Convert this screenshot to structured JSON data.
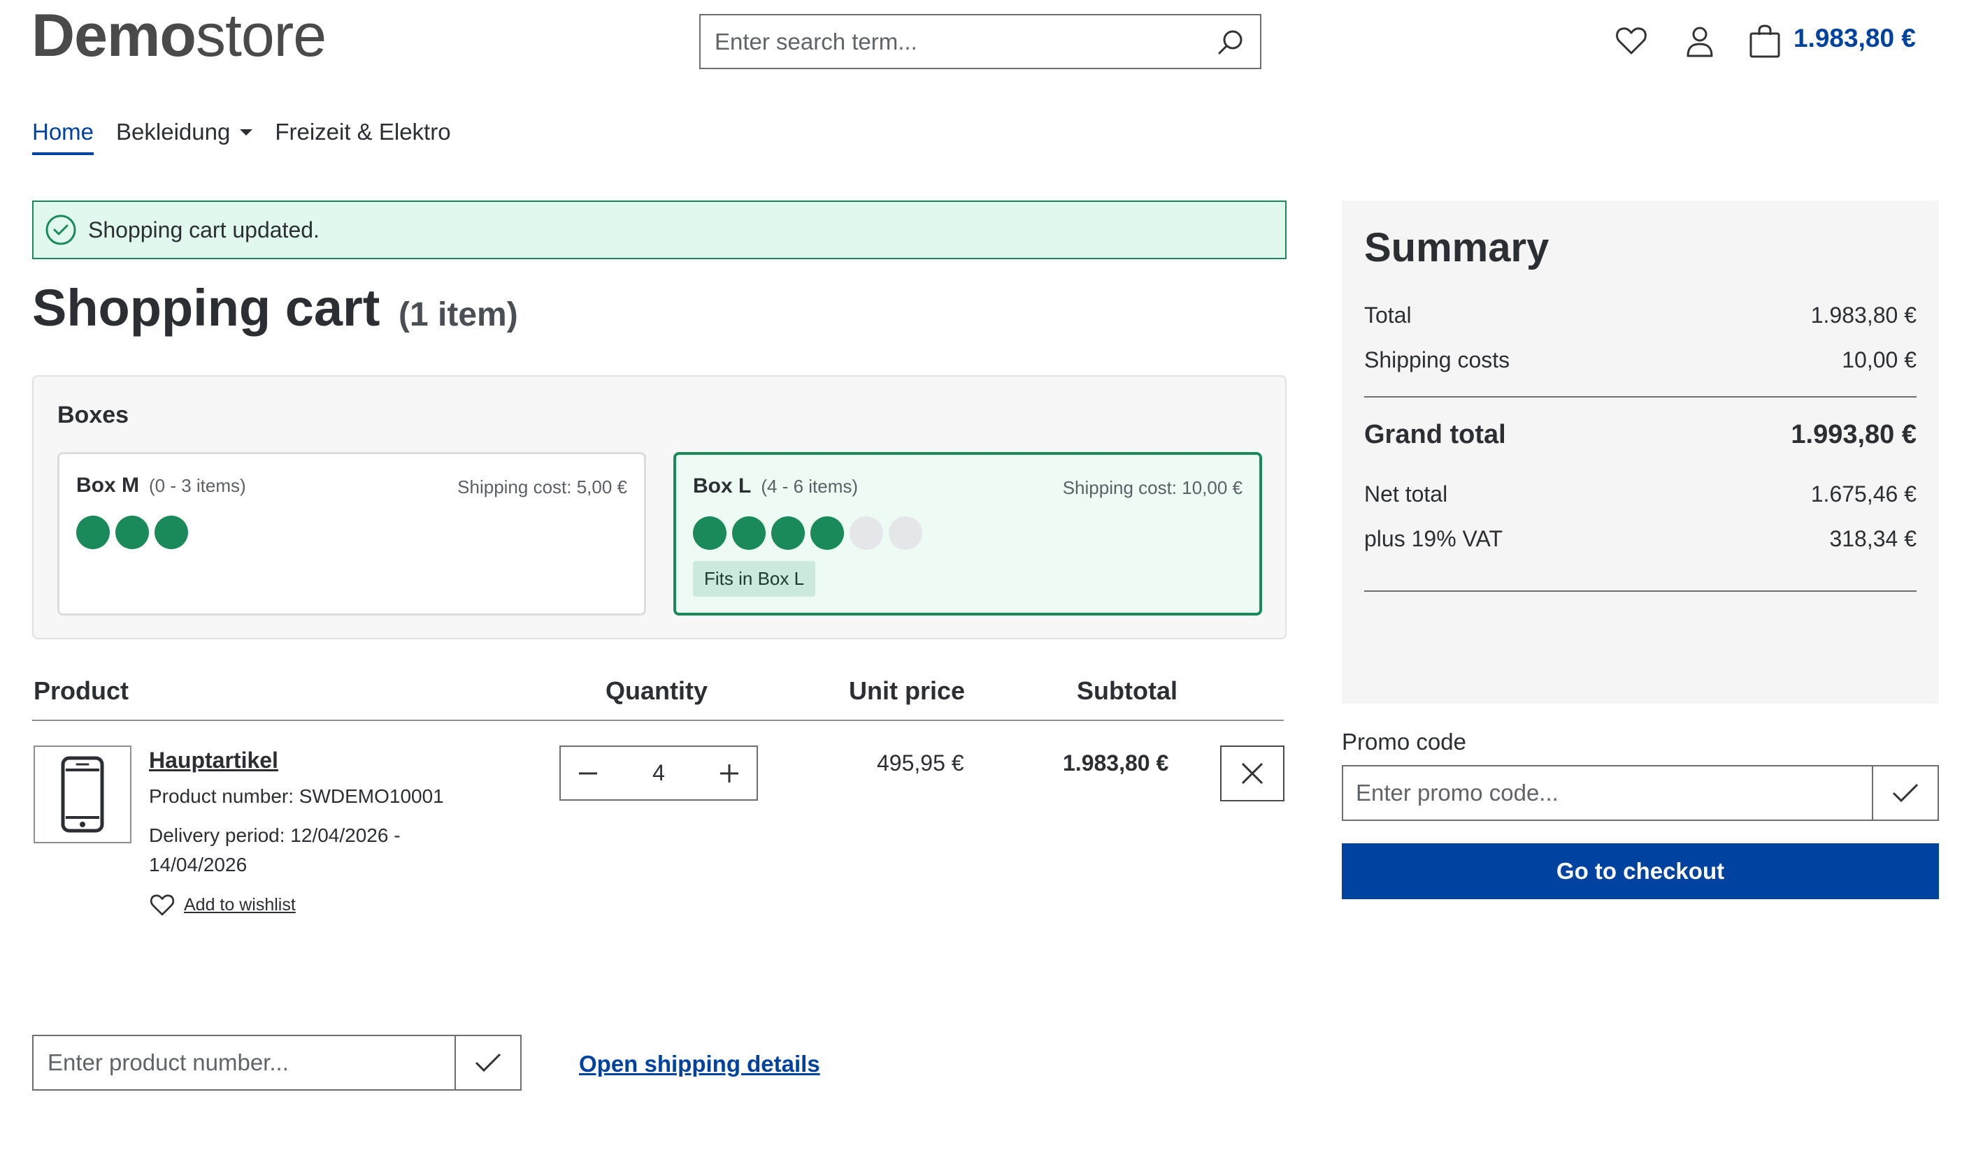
{
  "header": {
    "logo_bold": "Demo",
    "logo_regular": "store",
    "search_placeholder": "Enter search term...",
    "cart_total": "1.983,80 €",
    "icons": [
      "search-icon",
      "heart-icon",
      "user-icon",
      "bag-icon"
    ]
  },
  "nav": {
    "items": [
      {
        "label": "Home",
        "active": true
      },
      {
        "label": "Bekleidung",
        "has_dropdown": true
      },
      {
        "label": "Freizeit & Elektro"
      }
    ]
  },
  "alert": {
    "text": "Shopping cart updated.",
    "type": "success",
    "color": "#1b8a5a"
  },
  "cart": {
    "title": "Shopping cart",
    "count_text": "(1 item)"
  },
  "boxes": {
    "heading": "Boxes",
    "items": [
      {
        "name": "Box M",
        "range": "(0 - 3 items)",
        "shipping": "Shipping cost: 5,00 €",
        "capacity": 3,
        "filled": 3,
        "selected": false
      },
      {
        "name": "Box L",
        "range": "(4 - 6 items)",
        "shipping": "Shipping cost: 10,00 €",
        "capacity": 6,
        "filled": 4,
        "selected": true,
        "badge": "Fits in Box L"
      }
    ]
  },
  "table": {
    "headers": {
      "product": "Product",
      "quantity": "Quantity",
      "unit_price": "Unit price",
      "subtotal": "Subtotal"
    },
    "rows": [
      {
        "name": "Hauptartikel",
        "product_number": "Product number: SWDEMO10001",
        "delivery_line1": "Delivery period: 12/04/2026 -",
        "delivery_line2": "14/04/2026",
        "wishlist_label": "Add to wishlist",
        "quantity": "4",
        "unit_price": "495,95 €",
        "subtotal": "1.983,80 €"
      }
    ]
  },
  "product_number_input": {
    "placeholder": "Enter product number..."
  },
  "shipping_link": "Open shipping details",
  "summary": {
    "heading": "Summary",
    "total_label": "Total",
    "total_value": "1.983,80 €",
    "shipping_label": "Shipping costs",
    "shipping_value": "10,00 €",
    "grand_label": "Grand total",
    "grand_value": "1.993,80 €",
    "net_label": "Net total",
    "net_value": "1.675,46 €",
    "vat_label": "plus 19% VAT",
    "vat_value": "318,34 €"
  },
  "promo": {
    "label": "Promo code",
    "placeholder": "Enter promo code..."
  },
  "checkout_label": "Go to checkout",
  "colors": {
    "brand": "#0042a0",
    "success": "#1b8a5a",
    "alert_bg": "#e0f8ee",
    "dot_empty": "#e4e6ea"
  }
}
